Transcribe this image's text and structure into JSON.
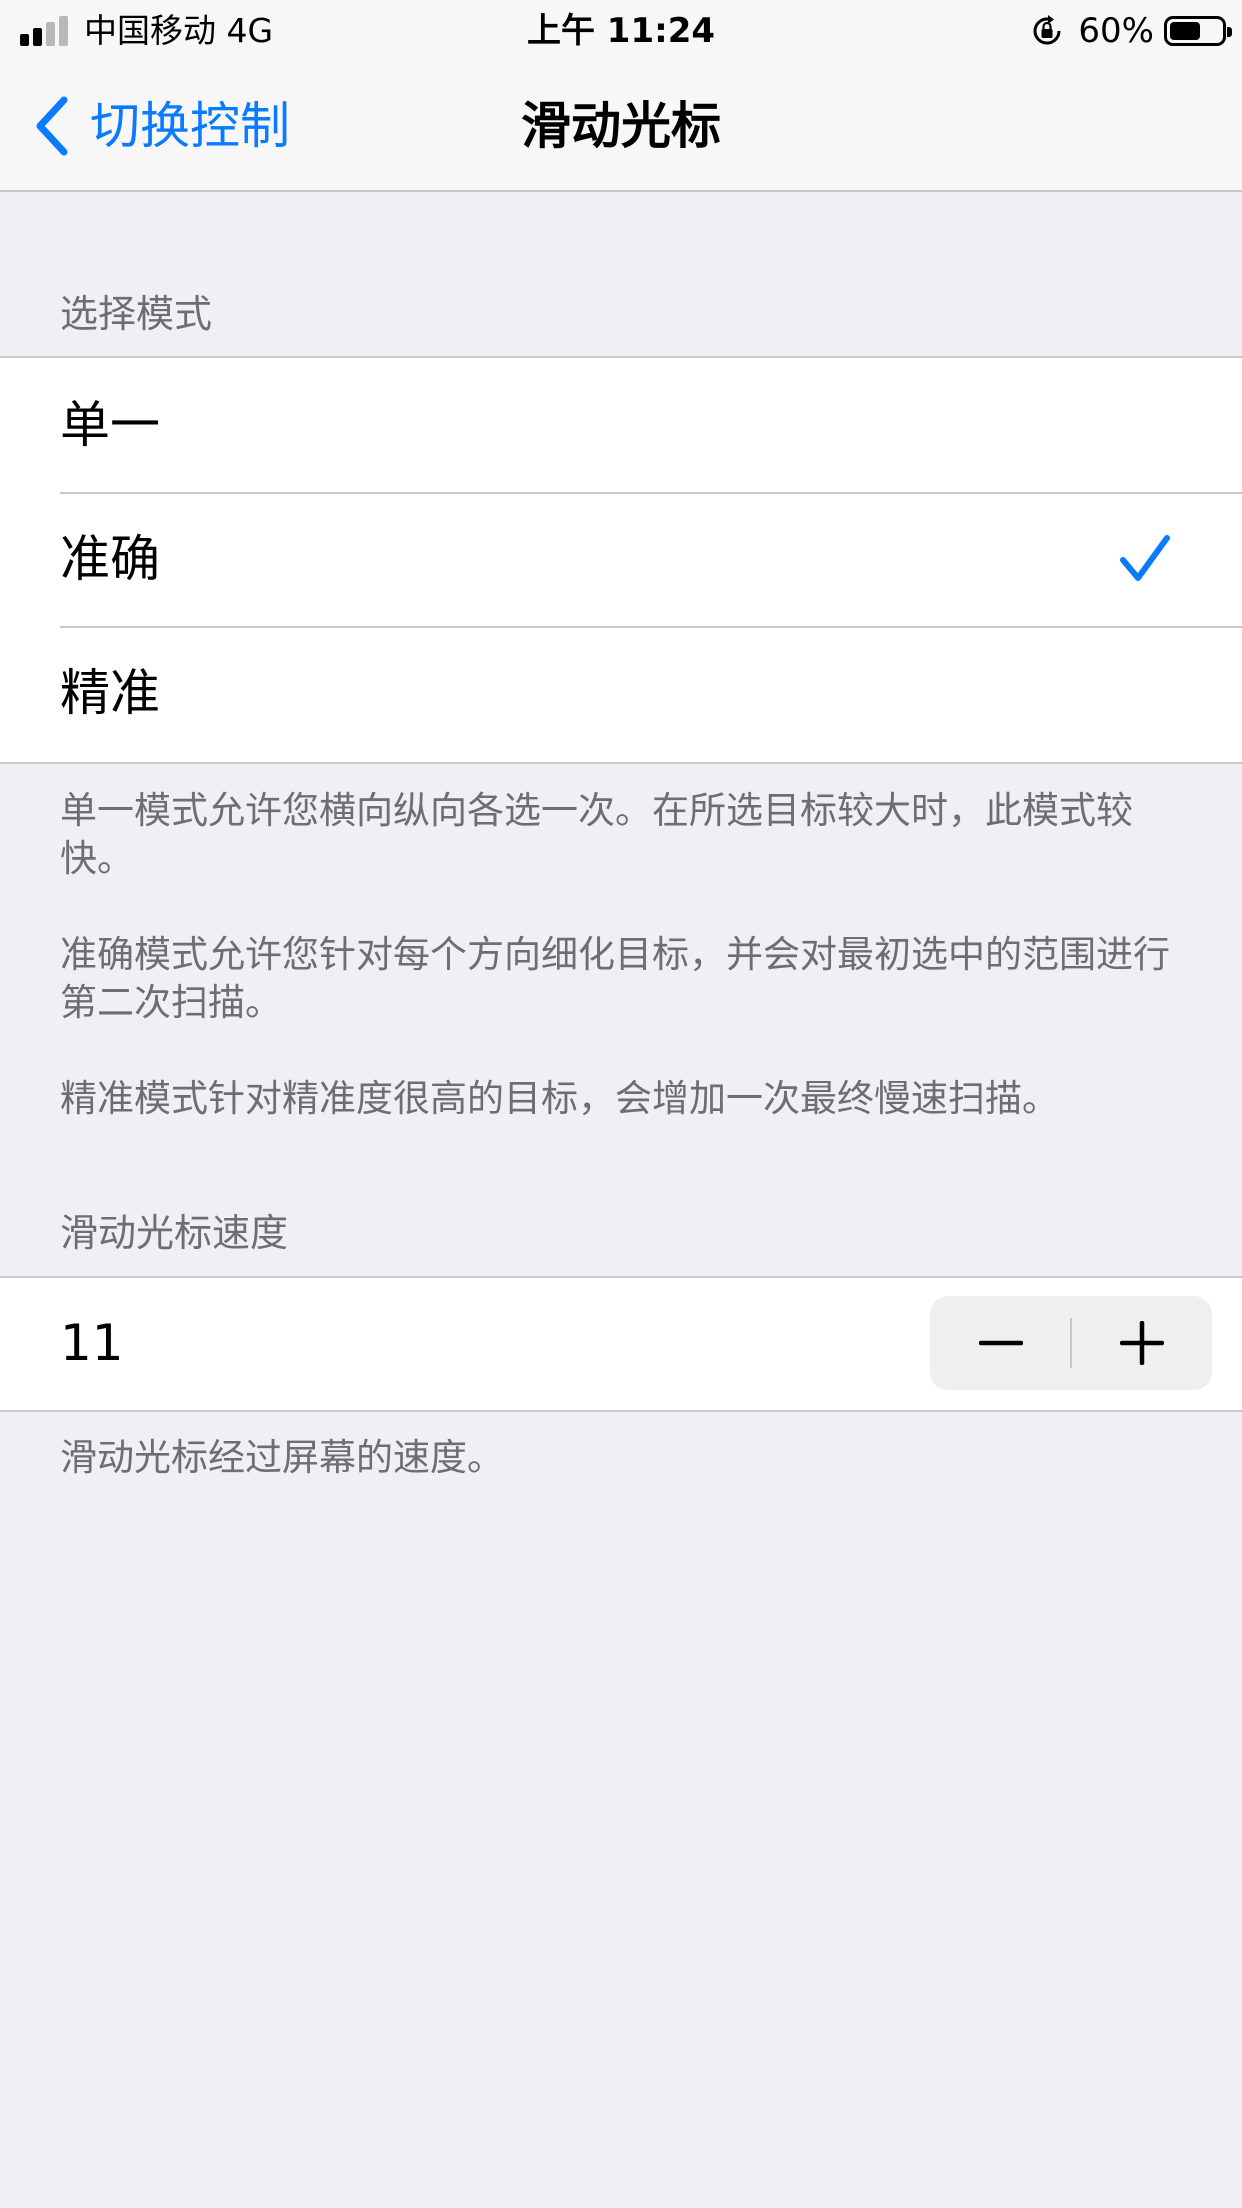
{
  "status_bar": {
    "carrier": "中国移动   4G",
    "time": "上午 11:24",
    "battery_percent": "60%",
    "battery_level": 0.6,
    "signal_bars_active": 2,
    "signal_bars_total": 4,
    "icons": [
      "signal-icon",
      "orientation-lock-icon",
      "battery-icon"
    ]
  },
  "nav": {
    "back_label": "切换控制",
    "title": "滑动光标",
    "back_icon": "chevron-left-icon"
  },
  "selection_mode": {
    "header": "选择模式",
    "options": [
      {
        "label": "单一",
        "selected": false
      },
      {
        "label": "准确",
        "selected": true
      },
      {
        "label": "精准",
        "selected": false
      }
    ],
    "descriptions": [
      "单一模式允许您横向纵向各选一次。在所选目标较大时，此模式较快。",
      "准确模式允许您针对每个方向细化目标，并会对最初选中的范围进行第二次扫描。",
      "精准模式针对精准度很高的目标，会增加一次最终慢速扫描。"
    ]
  },
  "speed": {
    "header": "滑动光标速度",
    "value": "11",
    "decrement_icon": "minus-icon",
    "increment_icon": "plus-icon",
    "footer": "滑动光标经过屏幕的速度。"
  },
  "colors": {
    "accent": "#0a7aff",
    "background": "#efeff4",
    "secondary_text": "#6d6d72"
  }
}
